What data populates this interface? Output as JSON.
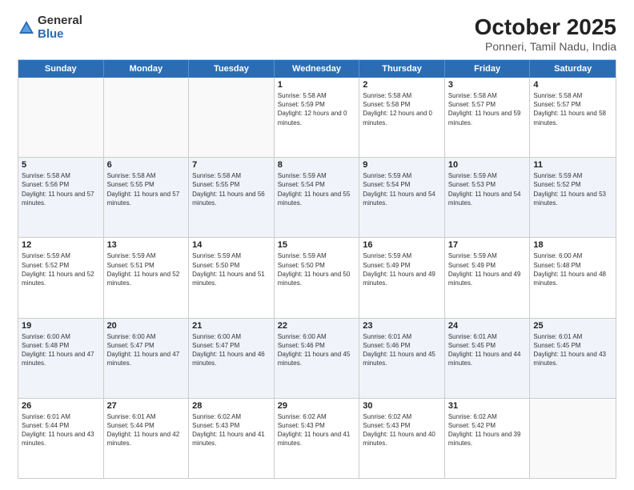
{
  "logo": {
    "general": "General",
    "blue": "Blue"
  },
  "title": "October 2025",
  "subtitle": "Ponneri, Tamil Nadu, India",
  "days_header": [
    "Sunday",
    "Monday",
    "Tuesday",
    "Wednesday",
    "Thursday",
    "Friday",
    "Saturday"
  ],
  "rows": [
    {
      "shaded": false,
      "cells": [
        {
          "empty": true
        },
        {
          "empty": true
        },
        {
          "empty": true
        },
        {
          "num": "1",
          "sunrise": "Sunrise: 5:58 AM",
          "sunset": "Sunset: 5:59 PM",
          "daylight": "Daylight: 12 hours and 0 minutes."
        },
        {
          "num": "2",
          "sunrise": "Sunrise: 5:58 AM",
          "sunset": "Sunset: 5:58 PM",
          "daylight": "Daylight: 12 hours and 0 minutes."
        },
        {
          "num": "3",
          "sunrise": "Sunrise: 5:58 AM",
          "sunset": "Sunset: 5:57 PM",
          "daylight": "Daylight: 11 hours and 59 minutes."
        },
        {
          "num": "4",
          "sunrise": "Sunrise: 5:58 AM",
          "sunset": "Sunset: 5:57 PM",
          "daylight": "Daylight: 11 hours and 58 minutes."
        }
      ]
    },
    {
      "shaded": true,
      "cells": [
        {
          "num": "5",
          "sunrise": "Sunrise: 5:58 AM",
          "sunset": "Sunset: 5:56 PM",
          "daylight": "Daylight: 11 hours and 57 minutes."
        },
        {
          "num": "6",
          "sunrise": "Sunrise: 5:58 AM",
          "sunset": "Sunset: 5:55 PM",
          "daylight": "Daylight: 11 hours and 57 minutes."
        },
        {
          "num": "7",
          "sunrise": "Sunrise: 5:58 AM",
          "sunset": "Sunset: 5:55 PM",
          "daylight": "Daylight: 11 hours and 56 minutes."
        },
        {
          "num": "8",
          "sunrise": "Sunrise: 5:59 AM",
          "sunset": "Sunset: 5:54 PM",
          "daylight": "Daylight: 11 hours and 55 minutes."
        },
        {
          "num": "9",
          "sunrise": "Sunrise: 5:59 AM",
          "sunset": "Sunset: 5:54 PM",
          "daylight": "Daylight: 11 hours and 54 minutes."
        },
        {
          "num": "10",
          "sunrise": "Sunrise: 5:59 AM",
          "sunset": "Sunset: 5:53 PM",
          "daylight": "Daylight: 11 hours and 54 minutes."
        },
        {
          "num": "11",
          "sunrise": "Sunrise: 5:59 AM",
          "sunset": "Sunset: 5:52 PM",
          "daylight": "Daylight: 11 hours and 53 minutes."
        }
      ]
    },
    {
      "shaded": false,
      "cells": [
        {
          "num": "12",
          "sunrise": "Sunrise: 5:59 AM",
          "sunset": "Sunset: 5:52 PM",
          "daylight": "Daylight: 11 hours and 52 minutes."
        },
        {
          "num": "13",
          "sunrise": "Sunrise: 5:59 AM",
          "sunset": "Sunset: 5:51 PM",
          "daylight": "Daylight: 11 hours and 52 minutes."
        },
        {
          "num": "14",
          "sunrise": "Sunrise: 5:59 AM",
          "sunset": "Sunset: 5:50 PM",
          "daylight": "Daylight: 11 hours and 51 minutes."
        },
        {
          "num": "15",
          "sunrise": "Sunrise: 5:59 AM",
          "sunset": "Sunset: 5:50 PM",
          "daylight": "Daylight: 11 hours and 50 minutes."
        },
        {
          "num": "16",
          "sunrise": "Sunrise: 5:59 AM",
          "sunset": "Sunset: 5:49 PM",
          "daylight": "Daylight: 11 hours and 49 minutes."
        },
        {
          "num": "17",
          "sunrise": "Sunrise: 5:59 AM",
          "sunset": "Sunset: 5:49 PM",
          "daylight": "Daylight: 11 hours and 49 minutes."
        },
        {
          "num": "18",
          "sunrise": "Sunrise: 6:00 AM",
          "sunset": "Sunset: 5:48 PM",
          "daylight": "Daylight: 11 hours and 48 minutes."
        }
      ]
    },
    {
      "shaded": true,
      "cells": [
        {
          "num": "19",
          "sunrise": "Sunrise: 6:00 AM",
          "sunset": "Sunset: 5:48 PM",
          "daylight": "Daylight: 11 hours and 47 minutes."
        },
        {
          "num": "20",
          "sunrise": "Sunrise: 6:00 AM",
          "sunset": "Sunset: 5:47 PM",
          "daylight": "Daylight: 11 hours and 47 minutes."
        },
        {
          "num": "21",
          "sunrise": "Sunrise: 6:00 AM",
          "sunset": "Sunset: 5:47 PM",
          "daylight": "Daylight: 11 hours and 46 minutes."
        },
        {
          "num": "22",
          "sunrise": "Sunrise: 6:00 AM",
          "sunset": "Sunset: 5:46 PM",
          "daylight": "Daylight: 11 hours and 45 minutes."
        },
        {
          "num": "23",
          "sunrise": "Sunrise: 6:01 AM",
          "sunset": "Sunset: 5:46 PM",
          "daylight": "Daylight: 11 hours and 45 minutes."
        },
        {
          "num": "24",
          "sunrise": "Sunrise: 6:01 AM",
          "sunset": "Sunset: 5:45 PM",
          "daylight": "Daylight: 11 hours and 44 minutes."
        },
        {
          "num": "25",
          "sunrise": "Sunrise: 6:01 AM",
          "sunset": "Sunset: 5:45 PM",
          "daylight": "Daylight: 11 hours and 43 minutes."
        }
      ]
    },
    {
      "shaded": false,
      "cells": [
        {
          "num": "26",
          "sunrise": "Sunrise: 6:01 AM",
          "sunset": "Sunset: 5:44 PM",
          "daylight": "Daylight: 11 hours and 43 minutes."
        },
        {
          "num": "27",
          "sunrise": "Sunrise: 6:01 AM",
          "sunset": "Sunset: 5:44 PM",
          "daylight": "Daylight: 11 hours and 42 minutes."
        },
        {
          "num": "28",
          "sunrise": "Sunrise: 6:02 AM",
          "sunset": "Sunset: 5:43 PM",
          "daylight": "Daylight: 11 hours and 41 minutes."
        },
        {
          "num": "29",
          "sunrise": "Sunrise: 6:02 AM",
          "sunset": "Sunset: 5:43 PM",
          "daylight": "Daylight: 11 hours and 41 minutes."
        },
        {
          "num": "30",
          "sunrise": "Sunrise: 6:02 AM",
          "sunset": "Sunset: 5:43 PM",
          "daylight": "Daylight: 11 hours and 40 minutes."
        },
        {
          "num": "31",
          "sunrise": "Sunrise: 6:02 AM",
          "sunset": "Sunset: 5:42 PM",
          "daylight": "Daylight: 11 hours and 39 minutes."
        },
        {
          "empty": true
        }
      ]
    }
  ]
}
